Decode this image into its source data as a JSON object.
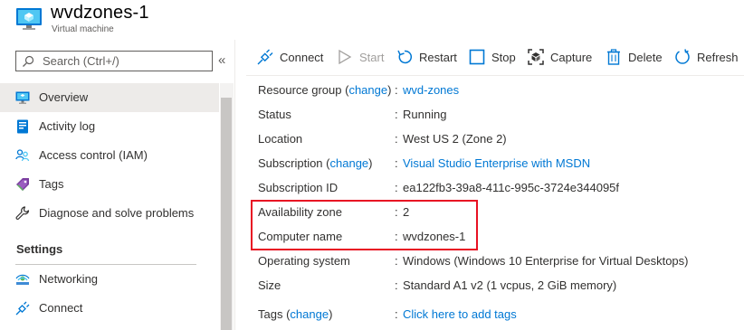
{
  "header": {
    "title": "wvdzones-1",
    "subtitle": "Virtual machine",
    "icon": "virtual-machine-icon"
  },
  "sidebar": {
    "search_placeholder": "Search (Ctrl+/)",
    "collapse_glyph": "«",
    "items": [
      {
        "label": "Overview",
        "icon": "monitor-icon",
        "selected": true
      },
      {
        "label": "Activity log",
        "icon": "activity-log-icon"
      },
      {
        "label": "Access control (IAM)",
        "icon": "people-icon"
      },
      {
        "label": "Tags",
        "icon": "tag-icon"
      },
      {
        "label": "Diagnose and solve problems",
        "icon": "wrench-icon"
      }
    ],
    "settings_heading": "Settings",
    "settings_items": [
      {
        "label": "Networking",
        "icon": "networking-icon"
      },
      {
        "label": "Connect",
        "icon": "plug-icon"
      }
    ]
  },
  "toolbar": {
    "buttons": [
      {
        "label": "Connect",
        "icon": "plug-icon",
        "enabled": true
      },
      {
        "label": "Start",
        "icon": "play-icon",
        "enabled": false
      },
      {
        "label": "Restart",
        "icon": "restart-icon",
        "enabled": true
      },
      {
        "label": "Stop",
        "icon": "stop-icon",
        "enabled": true
      },
      {
        "label": "Capture",
        "icon": "capture-icon",
        "enabled": true
      },
      {
        "label": "Delete",
        "icon": "trash-icon",
        "enabled": true
      },
      {
        "label": "Refresh",
        "icon": "refresh-icon",
        "enabled": true
      }
    ]
  },
  "essentials": {
    "colon": ":",
    "change_label": "change",
    "resource_group": {
      "key": "Resource group",
      "value": "wvd-zones"
    },
    "status": {
      "key": "Status",
      "value": "Running"
    },
    "location": {
      "key": "Location",
      "value": "West US 2 (Zone 2)"
    },
    "subscription": {
      "key": "Subscription",
      "value": "Visual Studio Enterprise with MSDN"
    },
    "subscription_id": {
      "key": "Subscription ID",
      "value": "ea122fb3-39a8-411c-995c-3724e344095f"
    },
    "availability_zone": {
      "key": "Availability zone",
      "value": "2"
    },
    "computer_name": {
      "key": "Computer name",
      "value": "wvdzones-1"
    },
    "operating_system": {
      "key": "Operating system",
      "value": "Windows (Windows 10 Enterprise for Virtual Desktops)"
    },
    "size": {
      "key": "Size",
      "value": "Standard A1 v2 (1 vcpus, 2 GiB memory)"
    },
    "tags": {
      "key": "Tags",
      "value": "Click here to add tags"
    }
  },
  "colors": {
    "accent": "#0078d4",
    "highlight_border": "#e81123",
    "selected_bg": "#edebe9"
  }
}
